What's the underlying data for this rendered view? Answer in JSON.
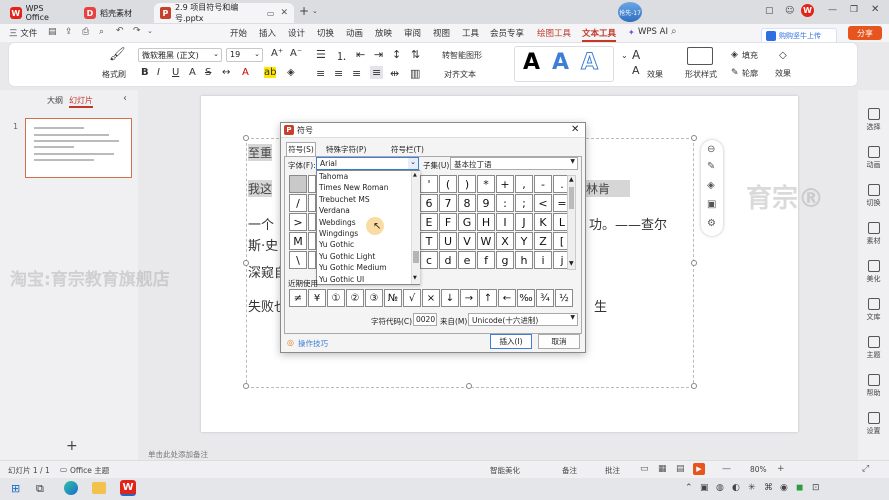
{
  "tabs": [
    {
      "label": "WPS Office"
    },
    {
      "label": "稻壳素材"
    },
    {
      "label": "2.9 项目符号和编号.pptx"
    }
  ],
  "window": {
    "add_tab": "+",
    "avatar_text": "抢先-17"
  },
  "menu": {
    "file": "三 文件",
    "items": [
      "开始",
      "插入",
      "设计",
      "切换",
      "动画",
      "放映",
      "审阅",
      "视图",
      "工具",
      "会员专享"
    ],
    "drawing_tools": "绘图工具",
    "text_tools": "文本工具",
    "wps_ai": "WPS AI",
    "share": "分享"
  },
  "promo": {
    "label": "购购坚牛上传"
  },
  "ribbon": {
    "format_painter": "格式刷",
    "font_name": "微软雅黑 (正文)",
    "font_size": "19",
    "smart_shape": "转智能图形",
    "align_text": "对齐文本",
    "text_effect": "效果",
    "fill": "填充",
    "outline": "轮廓",
    "effect": "效果",
    "shape_style": "形状样式",
    "sample_letter": "A"
  },
  "leftpane": {
    "tab_outline": "大纲",
    "tab_slides": "幻灯片",
    "slide_number": "1",
    "add": "+"
  },
  "slide": {
    "watermark_right": "育宗®",
    "watermark_left": "淘宝:育宗教育旗舰店",
    "lines": [
      "一个",
      "斯·史",
      "深窥自",
      "失败也"
    ],
    "right_lines": [
      "功。——查尔",
      "生"
    ],
    "top_text_1": "我这",
    "top_text_2": "林肯",
    "top_text_3": "至重"
  },
  "dialog": {
    "title": "符号",
    "tab_symbol": "符号(S)",
    "tab_special": "特殊字符(P)",
    "tab_symbol_bar": "符号栏(T)",
    "font_label": "字体(F):",
    "font_value": "Arial",
    "subset_label": "子集(U):",
    "subset_value": "基本拉丁语",
    "font_options": [
      "Tahoma",
      "Times New Roman",
      "Trebuchet MS",
      "Verdana",
      "Webdings",
      "Wingdings",
      "Yu Gothic",
      "Yu Gothic Light",
      "Yu Gothic Medium",
      "Yu Gothic UI"
    ],
    "symbols_left": [
      "/",
      ">",
      "M",
      "\\"
    ],
    "symbol_grid": [
      [
        "'",
        "(",
        ")",
        "*",
        "+",
        ",",
        "-",
        "."
      ],
      [
        "6",
        "7",
        "8",
        "9",
        ":",
        ";",
        "<",
        "="
      ],
      [
        "E",
        "F",
        "G",
        "H",
        "I",
        "J",
        "K",
        "L"
      ],
      [
        "T",
        "U",
        "V",
        "W",
        "X",
        "Y",
        "Z",
        "["
      ],
      [
        "c",
        "d",
        "e",
        "f",
        "g",
        "h",
        "i",
        "j"
      ]
    ],
    "recent_label": "近期使用",
    "recent_symbols": [
      "≠",
      "¥",
      "①",
      "②",
      "③",
      "№",
      "√",
      "×",
      "↓",
      "→",
      "↑",
      "←",
      "‰",
      "¾",
      "½"
    ],
    "code_label": "字符代码(C):",
    "code_value": "0020",
    "from_label": "来自(M)",
    "from_value": "Unicode(十六进制)",
    "tips": "操作技巧",
    "insert_btn": "插入(I)",
    "cancel_btn": "取消"
  },
  "rightbar": [
    "选择",
    "动画",
    "切换",
    "素材",
    "美化",
    "文库",
    "主题",
    "帮助",
    "设置"
  ],
  "status": {
    "slide_count": "幻灯片 1 / 1",
    "theme": "Office 主题",
    "notes_hint": "单击此处添加备注",
    "smart_beautify": "智能美化",
    "notes": "备注",
    "annotate": "批注",
    "zoom": "80%"
  }
}
